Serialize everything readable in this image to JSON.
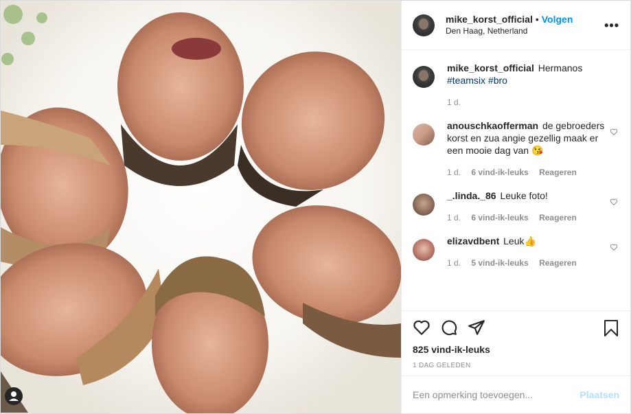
{
  "post": {
    "author": "mike_korst_official",
    "follow_label": "Volgen",
    "location": "Den Haag, Netherland",
    "more_label": "•••"
  },
  "caption": {
    "username": "mike_korst_official",
    "text": "Hermanos",
    "tags": [
      "#teamsix",
      "#bro"
    ],
    "time": "1 d."
  },
  "comments": [
    {
      "username": "anouschkaofferman",
      "text": "de gebroeders korst en zua angie gezellig maak er een mooie dag van 😘",
      "time": "1 d.",
      "likes": "6 vind-ik-leuks",
      "reply": "Reageren"
    },
    {
      "username": "_.linda._86",
      "text": "Leuke foto!",
      "time": "1 d.",
      "likes": "6 vind-ik-leuks",
      "reply": "Reageren"
    },
    {
      "username": "elizavdbent",
      "text": "Leuk👍",
      "time": "1 d.",
      "likes": "5 vind-ik-leuks",
      "reply": "Reageren"
    }
  ],
  "stats": {
    "likes": "825 vind-ik-leuks",
    "date": "1 DAG GELEDEN"
  },
  "add_comment": {
    "placeholder": "Een opmerking toevoegen...",
    "post_label": "Plaatsen"
  },
  "colors": {
    "link_blue": "#0095f6",
    "hashtag": "#00376b",
    "muted": "#8e8e8e",
    "post_button_disabled": "#b2dffc"
  }
}
